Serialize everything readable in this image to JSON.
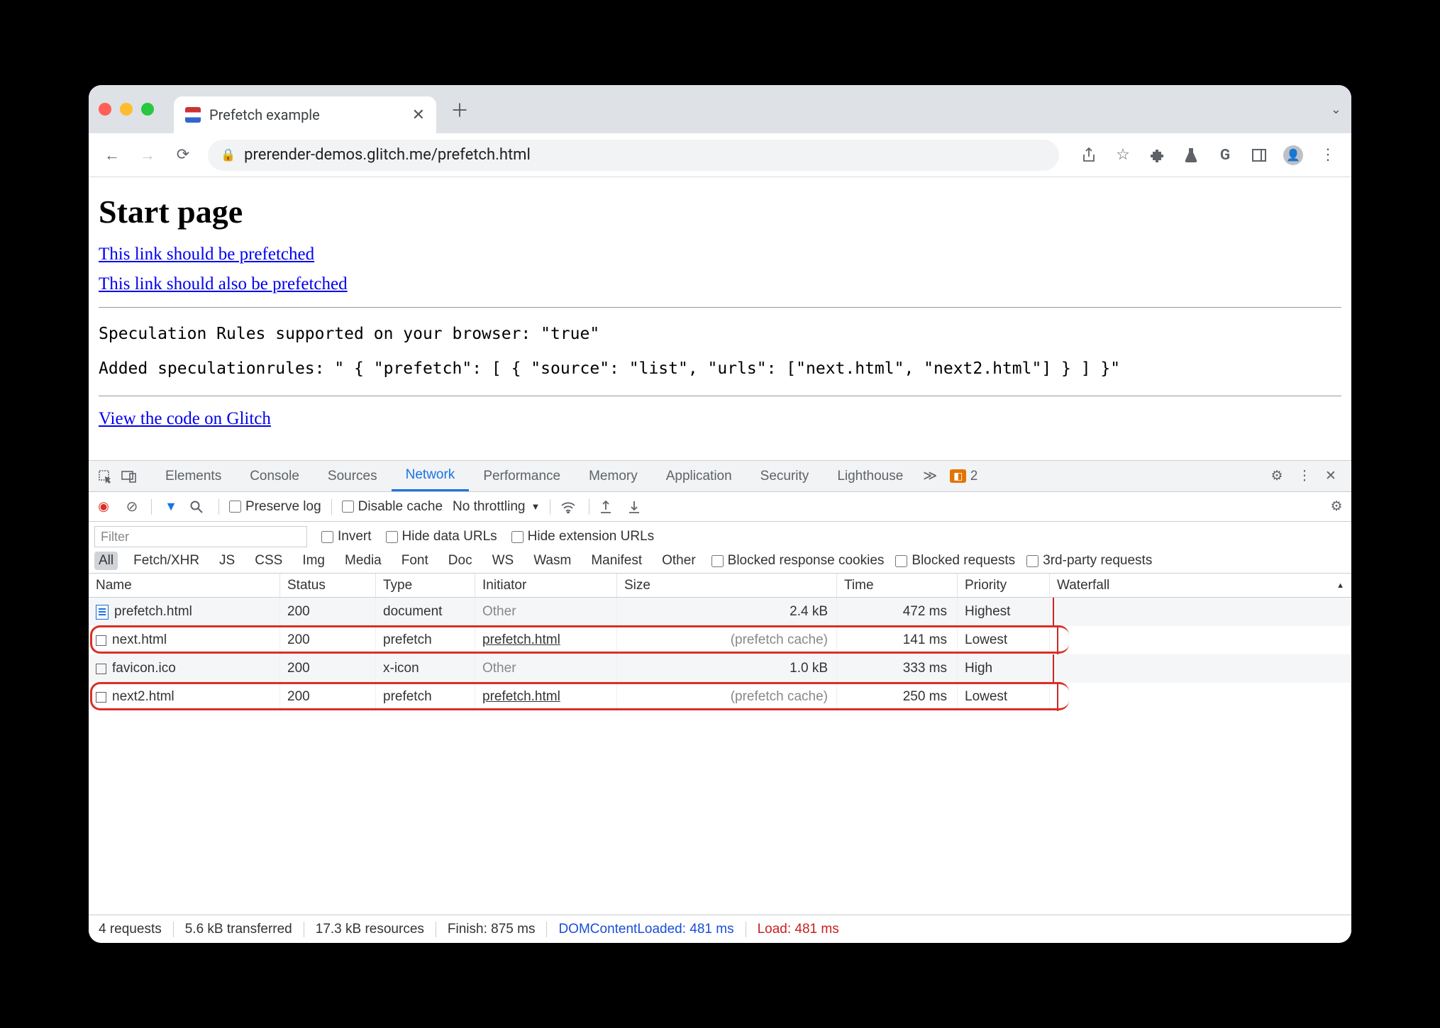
{
  "tab": {
    "title": "Prefetch example"
  },
  "url": "prerender-demos.glitch.me/prefetch.html",
  "page": {
    "heading": "Start page",
    "link1": "This link should be prefetched",
    "link2": "This link should also be prefetched",
    "mono_line1": "Speculation Rules supported on your browser: \"true\"",
    "mono_line2": "Added speculationrules: \" { \"prefetch\": [ { \"source\": \"list\", \"urls\": [\"next.html\", \"next2.html\"] } ] }\"",
    "link3": "View the code on Glitch"
  },
  "devtools": {
    "tabs": [
      "Elements",
      "Console",
      "Sources",
      "Network",
      "Performance",
      "Memory",
      "Application",
      "Security",
      "Lighthouse"
    ],
    "active_tab": "Network",
    "issues_count": "2",
    "controls": {
      "preserve_log": "Preserve log",
      "disable_cache": "Disable cache",
      "throttling": "No throttling"
    },
    "filter": {
      "placeholder": "Filter",
      "invert": "Invert",
      "hide_data": "Hide data URLs",
      "hide_ext": "Hide extension URLs",
      "types": [
        "All",
        "Fetch/XHR",
        "JS",
        "CSS",
        "Img",
        "Media",
        "Font",
        "Doc",
        "WS",
        "Wasm",
        "Manifest",
        "Other"
      ],
      "blocked_cookies": "Blocked response cookies",
      "blocked_requests": "Blocked requests",
      "third_party": "3rd-party requests"
    },
    "columns": {
      "name": "Name",
      "status": "Status",
      "type": "Type",
      "initiator": "Initiator",
      "size": "Size",
      "time": "Time",
      "priority": "Priority",
      "waterfall": "Waterfall"
    },
    "rows": [
      {
        "name": "prefetch.html",
        "status": "200",
        "type": "document",
        "initiator": "Other",
        "initiator_muted": true,
        "size": "2.4 kB",
        "size_muted": false,
        "time": "472 ms",
        "priority": "Highest",
        "icon": "doc",
        "hl": false
      },
      {
        "name": "next.html",
        "status": "200",
        "type": "prefetch",
        "initiator": "prefetch.html",
        "initiator_muted": false,
        "size": "(prefetch cache)",
        "size_muted": true,
        "time": "141 ms",
        "priority": "Lowest",
        "icon": "box",
        "hl": true
      },
      {
        "name": "favicon.ico",
        "status": "200",
        "type": "x-icon",
        "initiator": "Other",
        "initiator_muted": true,
        "size": "1.0 kB",
        "size_muted": false,
        "time": "333 ms",
        "priority": "High",
        "icon": "box",
        "hl": false
      },
      {
        "name": "next2.html",
        "status": "200",
        "type": "prefetch",
        "initiator": "prefetch.html",
        "initiator_muted": false,
        "size": "(prefetch cache)",
        "size_muted": true,
        "time": "250 ms",
        "priority": "Lowest",
        "icon": "box",
        "hl": true
      }
    ],
    "status": {
      "requests": "4 requests",
      "transferred": "5.6 kB transferred",
      "resources": "17.3 kB resources",
      "finish": "Finish: 875 ms",
      "dcl": "DOMContentLoaded: 481 ms",
      "load": "Load: 481 ms"
    }
  }
}
